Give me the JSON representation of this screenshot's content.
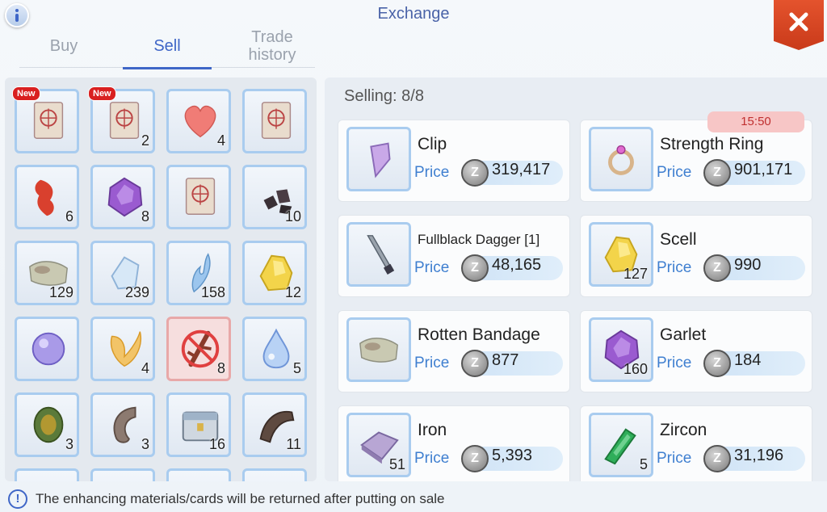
{
  "header": {
    "title": "Exchange",
    "info_icon": "info-icon",
    "close_icon": "close-x-icon",
    "accent": "#4a63a8"
  },
  "tabs": [
    {
      "label": "Buy",
      "active": false
    },
    {
      "label": "Sell",
      "active": true
    },
    {
      "label": "Trade\nhistory",
      "active": false
    }
  ],
  "inventory": {
    "new_badge": "New",
    "slots": [
      {
        "icon": "card-icon",
        "count": "",
        "new": true
      },
      {
        "icon": "card-icon",
        "count": "2",
        "new": true
      },
      {
        "icon": "heart-icon",
        "count": "4",
        "new": false
      },
      {
        "icon": "card-icon",
        "count": "",
        "new": false
      },
      {
        "icon": "red-herb-icon",
        "count": "6",
        "new": false
      },
      {
        "icon": "purple-gem-icon",
        "count": "8",
        "new": false
      },
      {
        "icon": "card-icon",
        "count": "",
        "new": false
      },
      {
        "icon": "coal-icon",
        "count": "10",
        "new": false
      },
      {
        "icon": "bandage-icon",
        "count": "129",
        "new": false
      },
      {
        "icon": "crystal-icon",
        "count": "239",
        "new": false
      },
      {
        "icon": "feather-icon",
        "count": "158",
        "new": false
      },
      {
        "icon": "yellow-gem-icon",
        "count": "12",
        "new": false
      },
      {
        "icon": "orb-icon",
        "count": "",
        "new": false
      },
      {
        "icon": "petal-icon",
        "count": "4",
        "new": false
      },
      {
        "icon": "disabled-item-icon",
        "count": "8",
        "new": false
      },
      {
        "icon": "droplet-icon",
        "count": "5",
        "new": false
      },
      {
        "icon": "shell-icon",
        "count": "3",
        "new": false
      },
      {
        "icon": "horn-icon",
        "count": "3",
        "new": false
      },
      {
        "icon": "chest-icon",
        "count": "16",
        "new": false
      },
      {
        "icon": "claw-icon",
        "count": "11",
        "new": false
      }
    ]
  },
  "selling": {
    "label": "Selling: 8/8",
    "price_label": "Price",
    "coin_symbol": "Z",
    "timer": "15:50",
    "items": [
      {
        "name": "Clip",
        "price": "319,417",
        "count": "",
        "icon": "clip-icon"
      },
      {
        "name": "Strength Ring",
        "price": "901,171",
        "count": "",
        "icon": "ring-icon"
      },
      {
        "name": "Fullblack Dagger [1]",
        "price": "48,165",
        "count": "",
        "icon": "dagger-icon"
      },
      {
        "name": "Scell",
        "price": "990",
        "count": "127",
        "icon": "yellow-gem-icon"
      },
      {
        "name": "Rotten Bandage",
        "price": "877",
        "count": "",
        "icon": "bandage-icon"
      },
      {
        "name": "Garlet",
        "price": "184",
        "count": "160",
        "icon": "purple-gem-icon"
      },
      {
        "name": "Iron",
        "price": "5,393",
        "count": "51",
        "icon": "iron-icon"
      },
      {
        "name": "Zircon",
        "price": "31,196",
        "count": "5",
        "icon": "green-crystal-icon"
      }
    ]
  },
  "footer": {
    "notice": "The enhancing materials/cards will be returned after putting on sale"
  }
}
